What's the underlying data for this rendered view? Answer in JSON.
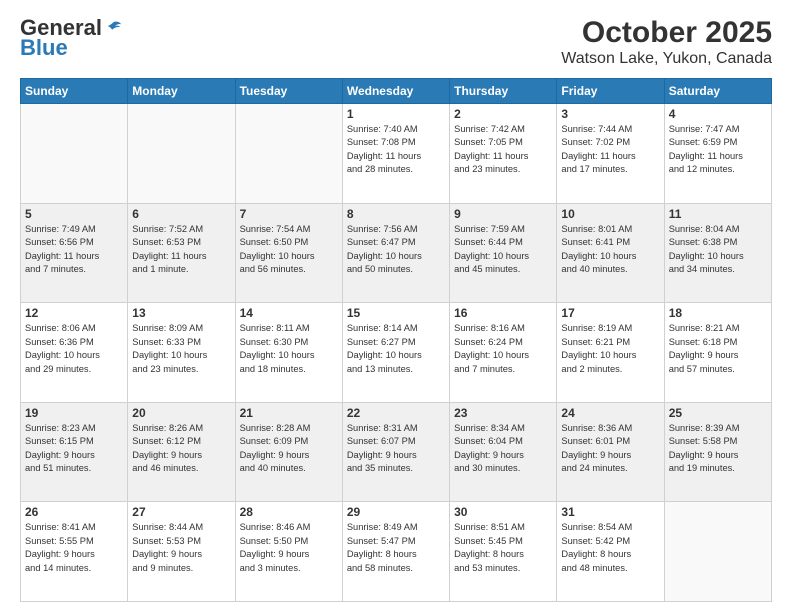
{
  "header": {
    "logo_general": "General",
    "logo_blue": "Blue",
    "title": "October 2025",
    "subtitle": "Watson Lake, Yukon, Canada"
  },
  "days_of_week": [
    "Sunday",
    "Monday",
    "Tuesday",
    "Wednesday",
    "Thursday",
    "Friday",
    "Saturday"
  ],
  "weeks": [
    {
      "shaded": false,
      "days": [
        {
          "num": "",
          "info": ""
        },
        {
          "num": "",
          "info": ""
        },
        {
          "num": "",
          "info": ""
        },
        {
          "num": "1",
          "info": "Sunrise: 7:40 AM\nSunset: 7:08 PM\nDaylight: 11 hours\nand 28 minutes."
        },
        {
          "num": "2",
          "info": "Sunrise: 7:42 AM\nSunset: 7:05 PM\nDaylight: 11 hours\nand 23 minutes."
        },
        {
          "num": "3",
          "info": "Sunrise: 7:44 AM\nSunset: 7:02 PM\nDaylight: 11 hours\nand 17 minutes."
        },
        {
          "num": "4",
          "info": "Sunrise: 7:47 AM\nSunset: 6:59 PM\nDaylight: 11 hours\nand 12 minutes."
        }
      ]
    },
    {
      "shaded": true,
      "days": [
        {
          "num": "5",
          "info": "Sunrise: 7:49 AM\nSunset: 6:56 PM\nDaylight: 11 hours\nand 7 minutes."
        },
        {
          "num": "6",
          "info": "Sunrise: 7:52 AM\nSunset: 6:53 PM\nDaylight: 11 hours\nand 1 minute."
        },
        {
          "num": "7",
          "info": "Sunrise: 7:54 AM\nSunset: 6:50 PM\nDaylight: 10 hours\nand 56 minutes."
        },
        {
          "num": "8",
          "info": "Sunrise: 7:56 AM\nSunset: 6:47 PM\nDaylight: 10 hours\nand 50 minutes."
        },
        {
          "num": "9",
          "info": "Sunrise: 7:59 AM\nSunset: 6:44 PM\nDaylight: 10 hours\nand 45 minutes."
        },
        {
          "num": "10",
          "info": "Sunrise: 8:01 AM\nSunset: 6:41 PM\nDaylight: 10 hours\nand 40 minutes."
        },
        {
          "num": "11",
          "info": "Sunrise: 8:04 AM\nSunset: 6:38 PM\nDaylight: 10 hours\nand 34 minutes."
        }
      ]
    },
    {
      "shaded": false,
      "days": [
        {
          "num": "12",
          "info": "Sunrise: 8:06 AM\nSunset: 6:36 PM\nDaylight: 10 hours\nand 29 minutes."
        },
        {
          "num": "13",
          "info": "Sunrise: 8:09 AM\nSunset: 6:33 PM\nDaylight: 10 hours\nand 23 minutes."
        },
        {
          "num": "14",
          "info": "Sunrise: 8:11 AM\nSunset: 6:30 PM\nDaylight: 10 hours\nand 18 minutes."
        },
        {
          "num": "15",
          "info": "Sunrise: 8:14 AM\nSunset: 6:27 PM\nDaylight: 10 hours\nand 13 minutes."
        },
        {
          "num": "16",
          "info": "Sunrise: 8:16 AM\nSunset: 6:24 PM\nDaylight: 10 hours\nand 7 minutes."
        },
        {
          "num": "17",
          "info": "Sunrise: 8:19 AM\nSunset: 6:21 PM\nDaylight: 10 hours\nand 2 minutes."
        },
        {
          "num": "18",
          "info": "Sunrise: 8:21 AM\nSunset: 6:18 PM\nDaylight: 9 hours\nand 57 minutes."
        }
      ]
    },
    {
      "shaded": true,
      "days": [
        {
          "num": "19",
          "info": "Sunrise: 8:23 AM\nSunset: 6:15 PM\nDaylight: 9 hours\nand 51 minutes."
        },
        {
          "num": "20",
          "info": "Sunrise: 8:26 AM\nSunset: 6:12 PM\nDaylight: 9 hours\nand 46 minutes."
        },
        {
          "num": "21",
          "info": "Sunrise: 8:28 AM\nSunset: 6:09 PM\nDaylight: 9 hours\nand 40 minutes."
        },
        {
          "num": "22",
          "info": "Sunrise: 8:31 AM\nSunset: 6:07 PM\nDaylight: 9 hours\nand 35 minutes."
        },
        {
          "num": "23",
          "info": "Sunrise: 8:34 AM\nSunset: 6:04 PM\nDaylight: 9 hours\nand 30 minutes."
        },
        {
          "num": "24",
          "info": "Sunrise: 8:36 AM\nSunset: 6:01 PM\nDaylight: 9 hours\nand 24 minutes."
        },
        {
          "num": "25",
          "info": "Sunrise: 8:39 AM\nSunset: 5:58 PM\nDaylight: 9 hours\nand 19 minutes."
        }
      ]
    },
    {
      "shaded": false,
      "days": [
        {
          "num": "26",
          "info": "Sunrise: 8:41 AM\nSunset: 5:55 PM\nDaylight: 9 hours\nand 14 minutes."
        },
        {
          "num": "27",
          "info": "Sunrise: 8:44 AM\nSunset: 5:53 PM\nDaylight: 9 hours\nand 9 minutes."
        },
        {
          "num": "28",
          "info": "Sunrise: 8:46 AM\nSunset: 5:50 PM\nDaylight: 9 hours\nand 3 minutes."
        },
        {
          "num": "29",
          "info": "Sunrise: 8:49 AM\nSunset: 5:47 PM\nDaylight: 8 hours\nand 58 minutes."
        },
        {
          "num": "30",
          "info": "Sunrise: 8:51 AM\nSunset: 5:45 PM\nDaylight: 8 hours\nand 53 minutes."
        },
        {
          "num": "31",
          "info": "Sunrise: 8:54 AM\nSunset: 5:42 PM\nDaylight: 8 hours\nand 48 minutes."
        },
        {
          "num": "",
          "info": ""
        }
      ]
    }
  ]
}
